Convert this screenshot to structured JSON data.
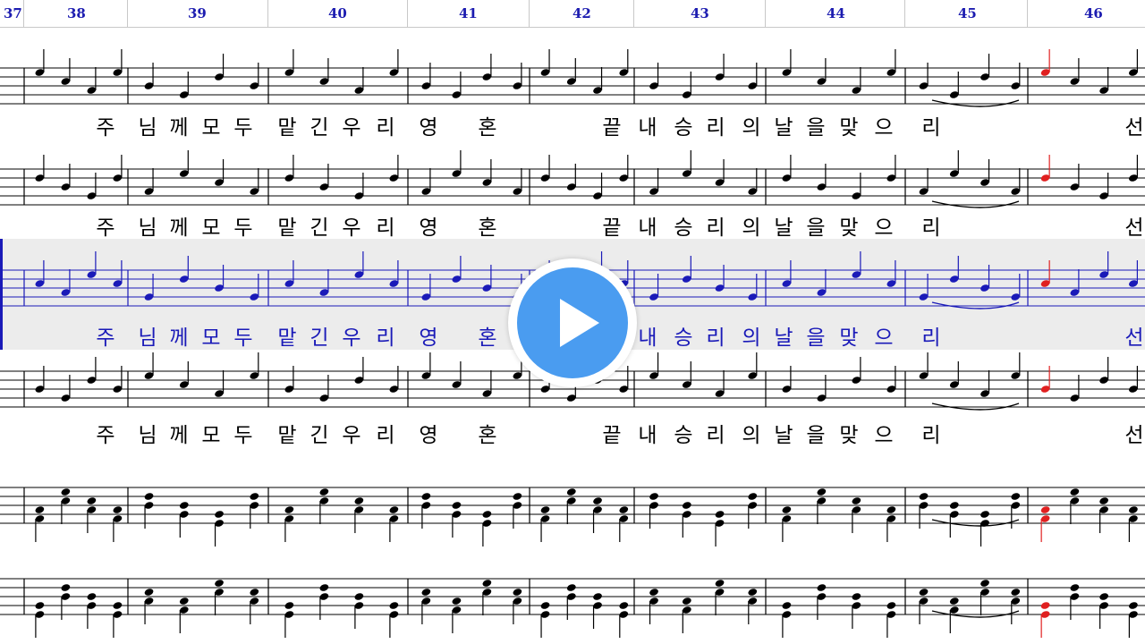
{
  "measures": [
    "37",
    "38",
    "39",
    "40",
    "41",
    "42",
    "43",
    "44",
    "45",
    "46"
  ],
  "lyrics": [
    "주",
    "님",
    "께",
    "모",
    "두",
    "맡",
    "긴",
    "우",
    "리",
    "영",
    "혼",
    "끝",
    "내",
    "승",
    "리",
    "의",
    "날",
    "을",
    "맞",
    "으",
    "리",
    "선"
  ],
  "colors": {
    "measure_number": "#1c1cb0",
    "staff": "#000000",
    "highlight": "#1a1ab8",
    "current_note": "#e02020",
    "band": "#ececec",
    "play_button": "#4a9cf0"
  },
  "staves": [
    {
      "name": "voice-1",
      "highlighted": false
    },
    {
      "name": "voice-2",
      "highlighted": false
    },
    {
      "name": "voice-3",
      "highlighted": true
    },
    {
      "name": "voice-4",
      "highlighted": false
    },
    {
      "name": "piano-right",
      "highlighted": false
    },
    {
      "name": "piano-left",
      "highlighted": false
    }
  ],
  "play_button": {
    "icon": "play-icon"
  }
}
